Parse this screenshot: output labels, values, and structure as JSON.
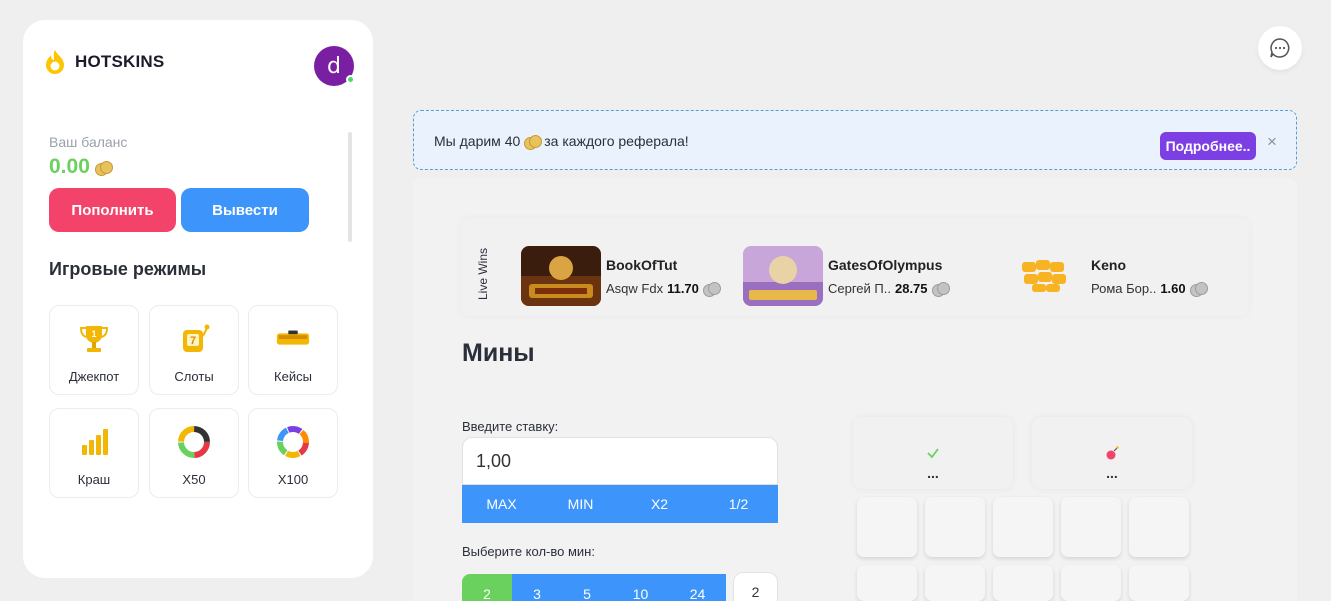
{
  "brand": {
    "name": "HOTSKINS",
    "avatar_letter": "d"
  },
  "balance": {
    "label": "Ваш баланс",
    "value": "0.00"
  },
  "actions": {
    "deposit": "Пополнить",
    "withdraw": "Вывести"
  },
  "modes": {
    "title": "Игровые режимы",
    "items": [
      {
        "label": "Джекпот",
        "icon": "trophy-icon"
      },
      {
        "label": "Слоты",
        "icon": "slot-machine-icon"
      },
      {
        "label": "Кейсы",
        "icon": "case-icon"
      },
      {
        "label": "Краш",
        "icon": "crash-chart-icon"
      },
      {
        "label": "X50",
        "icon": "wheel-x50-icon"
      },
      {
        "label": "X100",
        "icon": "wheel-x100-icon"
      }
    ]
  },
  "banner": {
    "text_before": "Мы дарим 40",
    "text_after": "за каждого реферала!",
    "button": "Подробнее..",
    "close": "×"
  },
  "live_wins": {
    "label": "Live Wins",
    "items": [
      {
        "game": "BookOfTut",
        "user": "Asqw Fdx",
        "amount": "11.70"
      },
      {
        "game": "GatesOfOlympus",
        "user": "Сергей П..",
        "amount": "28.75"
      },
      {
        "game": "Keno",
        "user": "Рома Бор..",
        "amount": "1.60"
      }
    ]
  },
  "game": {
    "title": "Мины",
    "bet_label": "Введите ставку:",
    "bet_value": "1,00",
    "bet_buttons": [
      "MAX",
      "MIN",
      "X2",
      "1/2"
    ],
    "mines_label": "Выберите кол-во мин:",
    "mines_options": [
      "2",
      "3",
      "5",
      "10",
      "24"
    ],
    "mines_value": "2",
    "stats": [
      {
        "icon": "check-icon",
        "value": "..."
      },
      {
        "icon": "bomb-icon",
        "value": "..."
      }
    ]
  },
  "colors": {
    "accent_blue": "#3d95fc",
    "accent_red": "#f3436a",
    "accent_green": "#6ad15f",
    "accent_purple": "#7b3fe4"
  }
}
